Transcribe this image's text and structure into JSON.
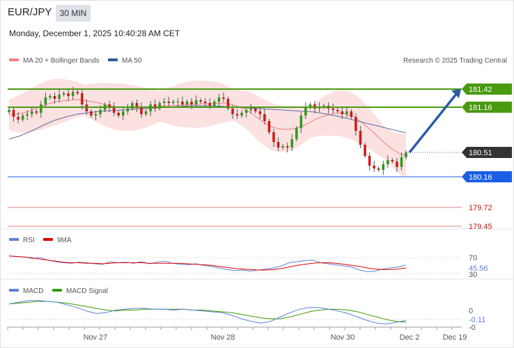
{
  "header": {
    "symbol": "EUR/JPY",
    "interval": "30 MIN",
    "timestamp": "Monday, December 1, 2025 10:40:28 AM CET"
  },
  "legend": {
    "main": [
      {
        "label": "MA 20 + Bollinger Bands",
        "color": "#f08080"
      },
      {
        "label": "MA 50",
        "color": "#2e5a9c"
      }
    ],
    "rsi": [
      {
        "label": "RSI",
        "color": "#5b7fdb"
      },
      {
        "label": "9MA",
        "color": "#e00000"
      }
    ],
    "macd": [
      {
        "label": "MACD",
        "color": "#5b7fdb"
      },
      {
        "label": "MACD Signal",
        "color": "#3a9a00"
      }
    ]
  },
  "copyright": "Research © 2025 Trading Central",
  "chart_data": [
    {
      "type": "candlestick",
      "panel": "price",
      "ylim": [
        179.35,
        181.75
      ],
      "levels": [
        {
          "value": 181.42,
          "label": "181.42",
          "kind": "resistance",
          "color": "#4a9a10"
        },
        {
          "value": 181.16,
          "label": "181.16",
          "kind": "resistance",
          "color": "#4a9a10"
        },
        {
          "value": 180.51,
          "label": "180.51",
          "kind": "last",
          "color": "#333333"
        },
        {
          "value": 180.16,
          "label": "180.16",
          "kind": "pivot",
          "color": "#1a5ee6"
        },
        {
          "value": 179.72,
          "label": "179.72",
          "kind": "support",
          "color": "#cc1111"
        },
        {
          "value": 179.45,
          "label": "179.45",
          "kind": "support",
          "color": "#cc1111"
        }
      ],
      "closes": [
        181.12,
        181.02,
        180.98,
        181.04,
        181.06,
        181.1,
        181.08,
        181.2,
        181.3,
        181.32,
        181.28,
        181.34,
        181.36,
        181.32,
        181.38,
        181.36,
        181.2,
        181.1,
        181.04,
        181.06,
        181.12,
        181.2,
        181.16,
        181.08,
        181.04,
        181.1,
        181.14,
        181.22,
        181.16,
        181.06,
        181.1,
        181.2,
        181.14,
        181.22,
        181.24,
        181.22,
        181.24,
        181.24,
        181.2,
        181.24,
        181.2,
        181.26,
        181.24,
        181.22,
        181.18,
        181.24,
        181.3,
        181.28,
        181.14,
        181.06,
        181.04,
        181.08,
        181.12,
        181.14,
        181.1,
        181.06,
        180.96,
        180.8,
        180.66,
        180.58,
        180.6,
        180.58,
        180.7,
        180.86,
        181.04,
        181.16,
        181.2,
        181.14,
        181.16,
        181.18,
        181.14,
        181.12,
        181.1,
        181.06,
        181.1,
        181.02,
        180.82,
        180.62,
        180.46,
        180.32,
        180.28,
        180.26,
        180.34,
        180.4,
        180.38,
        180.3,
        180.44,
        180.51
      ],
      "ma20": [
        181.05,
        181.06,
        181.08,
        181.12,
        181.16,
        181.2,
        181.23,
        181.25,
        181.26,
        181.27,
        181.26,
        181.24,
        181.22,
        181.19,
        181.17,
        181.16,
        181.15,
        181.15,
        181.15,
        181.16,
        181.17,
        181.18,
        181.18,
        181.19,
        181.2,
        181.2,
        181.21,
        181.21,
        181.22,
        181.21,
        181.19,
        181.15,
        181.1,
        181.02,
        180.94,
        180.88,
        180.85,
        180.84,
        180.85,
        180.88,
        180.93,
        180.99,
        181.03,
        181.06,
        181.08,
        181.06,
        181.02,
        180.95,
        180.86,
        180.76,
        180.66,
        180.57,
        180.5,
        180.46
      ],
      "ma50": [
        180.7,
        180.75,
        180.82,
        180.9,
        180.97,
        181.02,
        181.06,
        181.08,
        181.1,
        181.11,
        181.12,
        181.13,
        181.14,
        181.15,
        181.16,
        181.17,
        181.18,
        181.18,
        181.18,
        181.17,
        181.16,
        181.15,
        181.14,
        181.13,
        181.12,
        181.11,
        181.1,
        181.09,
        181.06,
        181.03,
        180.99,
        180.95,
        180.91,
        180.87,
        180.83,
        180.79
      ]
    },
    {
      "type": "line",
      "panel": "rsi",
      "series_names": [
        "RSI",
        "9MA"
      ],
      "ticks": [
        "70",
        "30"
      ],
      "last_value": "45.56",
      "rsi": [
        63,
        62,
        61,
        58,
        60,
        55,
        52,
        50,
        49,
        51,
        50,
        48,
        47,
        52,
        50,
        51,
        49,
        52,
        48,
        51,
        53,
        49,
        47,
        46,
        48,
        45,
        43,
        40,
        37,
        35,
        36,
        34,
        36,
        38,
        40,
        44,
        50,
        52,
        54,
        55,
        50,
        48,
        46,
        44,
        42,
        36,
        33,
        34,
        38,
        40,
        42,
        45.56
      ],
      "ma9": [
        63,
        62,
        61,
        59,
        57,
        55,
        53,
        51,
        50,
        50,
        49,
        49,
        48,
        49,
        50,
        50,
        50,
        50,
        49,
        49,
        49,
        49,
        49,
        48,
        47,
        46,
        45,
        43,
        41,
        39,
        38,
        37,
        36,
        36,
        37,
        39,
        42,
        45,
        47,
        49,
        50,
        50,
        49,
        47,
        45,
        43,
        40,
        38,
        37,
        37,
        38,
        40
      ]
    },
    {
      "type": "line",
      "panel": "macd",
      "series_names": [
        "MACD",
        "MACD Signal"
      ],
      "ticks": [
        "0",
        "-0"
      ],
      "last_value": "-0.11",
      "macd": [
        0.08,
        0.1,
        0.12,
        0.12,
        0.11,
        0.1,
        0.07,
        0.04,
        0.0,
        -0.03,
        -0.02,
        0.01,
        0.02,
        0.03,
        0.03,
        0.02,
        0.02,
        0.01,
        0.02,
        0.01,
        0.0,
        -0.01,
        -0.02,
        -0.05,
        -0.09,
        -0.12,
        -0.14,
        -0.12,
        -0.07,
        -0.02,
        0.02,
        0.04,
        0.04,
        0.02,
        0.0,
        -0.03,
        -0.07,
        -0.11,
        -0.14,
        -0.15,
        -0.13,
        -0.11
      ],
      "signal": [
        0.08,
        0.09,
        0.1,
        0.11,
        0.11,
        0.1,
        0.09,
        0.07,
        0.05,
        0.03,
        0.01,
        0.0,
        0.01,
        0.01,
        0.02,
        0.02,
        0.02,
        0.02,
        0.02,
        0.01,
        0.01,
        0.0,
        -0.01,
        -0.02,
        -0.04,
        -0.06,
        -0.08,
        -0.09,
        -0.09,
        -0.07,
        -0.04,
        -0.01,
        0.01,
        0.02,
        0.02,
        0.01,
        -0.01,
        -0.04,
        -0.07,
        -0.1,
        -0.12,
        -0.13
      ]
    }
  ],
  "xaxis": {
    "labels": [
      "Nov 27",
      "Nov 28",
      "Nov 30",
      "Dec 2",
      "Dec 19"
    ]
  }
}
